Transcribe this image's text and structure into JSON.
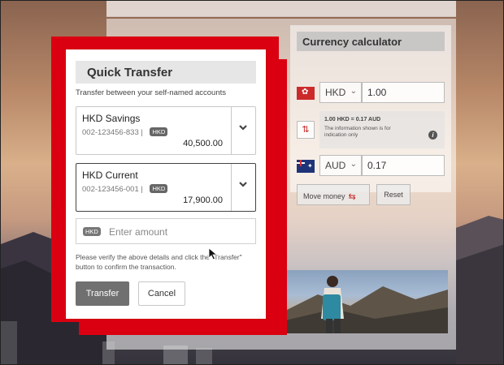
{
  "modal": {
    "title": "Quick Transfer",
    "subtitle": "Transfer between your self-named accounts",
    "accounts": [
      {
        "name": "HKD Savings",
        "number": "002-123456-833",
        "separator": "|",
        "currency": "HKD",
        "balance": "40,500.00"
      },
      {
        "name": "HKD Current",
        "number": "002-123456-001",
        "separator": "|",
        "currency": "HKD",
        "balance": "17,900.00"
      }
    ],
    "amount": {
      "currency": "HKD",
      "placeholder": "Enter amount"
    },
    "verify_text": "Please verify the above details and click the \"Transfer\" button to confirm the transaction.",
    "transfer_label": "Transfer",
    "cancel_label": "Cancel"
  },
  "calculator": {
    "title": "Currency calculator",
    "from": {
      "currency": "HKD",
      "value": "1.00",
      "flag": "hong-kong-flag-icon"
    },
    "to": {
      "currency": "AUD",
      "value": "0.17",
      "flag": "australia-flag-icon"
    },
    "rate": "1.00 HKD = 0.17 AUD",
    "note": "The information shown is for indication only",
    "move_money_label": "Move money",
    "reset_label": "Reset"
  },
  "colors": {
    "brand_red": "#db0011",
    "button_gray": "#707070"
  },
  "icons": [
    "chevron-down-icon",
    "swap-icon",
    "info-icon",
    "move-money-icon",
    "mouse-cursor-icon"
  ]
}
